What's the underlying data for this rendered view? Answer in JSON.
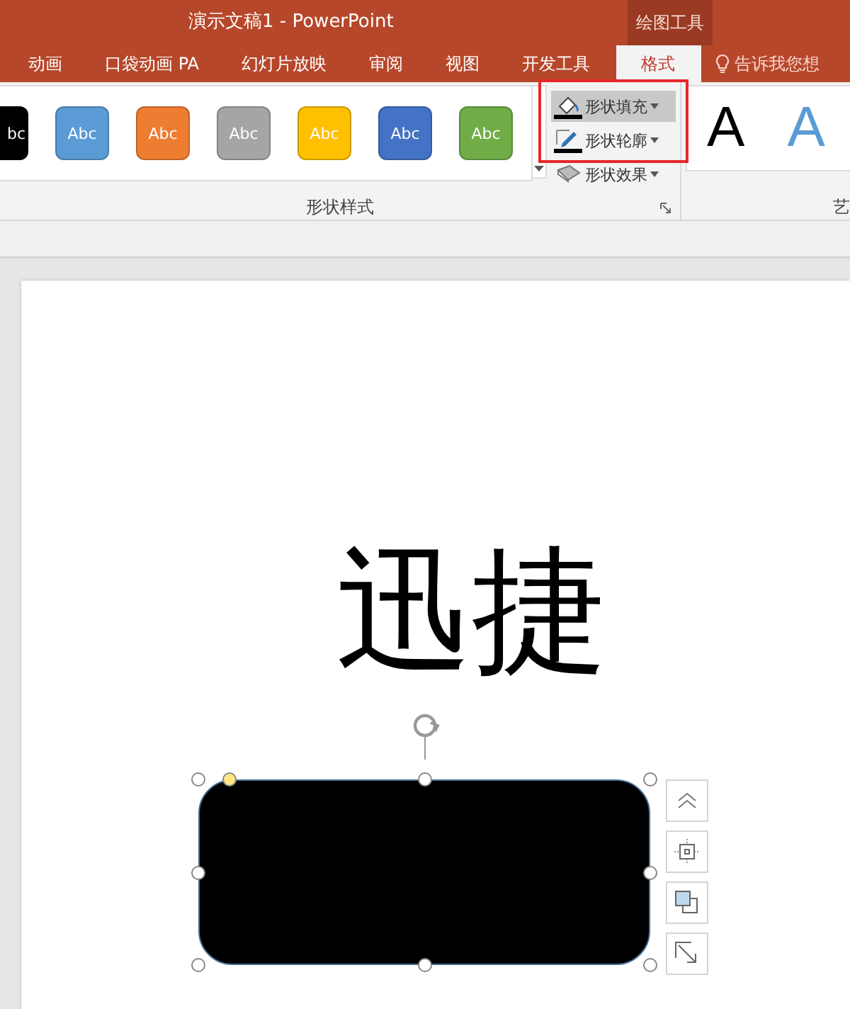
{
  "window": {
    "title": "演示文稿1 - PowerPoint",
    "context_tab": "绘图工具"
  },
  "tabs": [
    {
      "label": "动画",
      "selected": false
    },
    {
      "label": "口袋动画 PA",
      "selected": false
    },
    {
      "label": "幻灯片放映",
      "selected": false
    },
    {
      "label": "审阅",
      "selected": false
    },
    {
      "label": "视图",
      "selected": false
    },
    {
      "label": "开发工具",
      "selected": false
    },
    {
      "label": "格式",
      "selected": true
    }
  ],
  "tell_me": "告诉我您想",
  "shape_styles": {
    "label": "形状样式",
    "swatches": [
      {
        "label": "bc",
        "color": "#000000"
      },
      {
        "label": "Abc",
        "color": "#5b9bd5"
      },
      {
        "label": "Abc",
        "color": "#ed7d31"
      },
      {
        "label": "Abc",
        "color": "#a5a5a5"
      },
      {
        "label": "Abc",
        "color": "#ffc000"
      },
      {
        "label": "Abc",
        "color": "#4472c4"
      },
      {
        "label": "Abc",
        "color": "#70ad47"
      }
    ]
  },
  "shape_commands": [
    {
      "kind": "fill",
      "label": "形状填充",
      "highlighted": true
    },
    {
      "kind": "outline",
      "label": "形状轮廓",
      "highlighted": false
    },
    {
      "kind": "effects",
      "label": "形状效果",
      "highlighted": false
    }
  ],
  "wordart": {
    "label": "艺",
    "samples": [
      {
        "letter": "A",
        "color": "#000000"
      },
      {
        "letter": "A",
        "color": "#5b9bd5"
      }
    ]
  },
  "slide": {
    "text": "迅捷"
  }
}
